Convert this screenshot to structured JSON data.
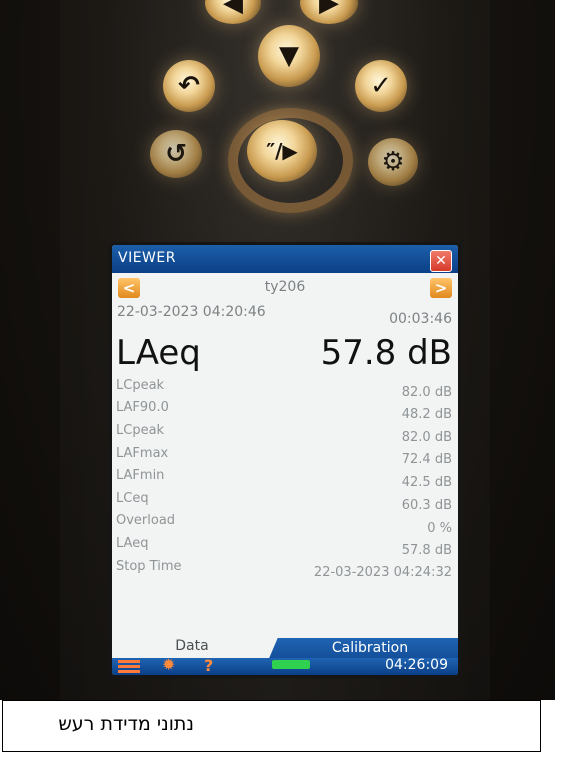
{
  "device": {
    "keypad": {
      "keys": [
        "left-key",
        "up-key",
        "right-key",
        "back-key",
        "down-key",
        "check-key",
        "undo-key",
        "play-pause-key",
        "settings-key"
      ]
    },
    "screen": {
      "window_title": "VIEWER",
      "close_glyph": "✕",
      "prev_glyph": "<",
      "next_glyph": ">",
      "file_name": "ty206",
      "start_datetime": "22-03-2023 04:20:46",
      "elapsed": "00:03:46",
      "main_metric": {
        "label": "LAeq",
        "value": "57.8 dB"
      },
      "rows": [
        {
          "label": "LCpeak",
          "value": "82.0 dB"
        },
        {
          "label": "LAF90.0",
          "value": "48.2 dB"
        },
        {
          "label": "LCpeak",
          "value": "82.0 dB"
        },
        {
          "label": "LAFmax",
          "value": "72.4 dB"
        },
        {
          "label": "LAFmin",
          "value": "42.5 dB"
        },
        {
          "label": "LCeq",
          "value": "60.3 dB"
        },
        {
          "label": "Overload",
          "value": "0 %"
        },
        {
          "label": "LAeq",
          "value": "57.8 dB"
        },
        {
          "label": "Stop Time",
          "value": "22-03-2023 04:24:32"
        }
      ],
      "tabs": {
        "data": "Data",
        "calibration": "Calibration"
      },
      "status": {
        "help_glyph": "?",
        "clock": "04:26:09"
      }
    }
  },
  "caption": {
    "text": "נתוני מדידת רעש"
  },
  "colors": {
    "titlebar": "#0a3f86",
    "accent_orange": "#e0891c",
    "close_red": "#d63a2a",
    "battery_green": "#2fd14f"
  }
}
